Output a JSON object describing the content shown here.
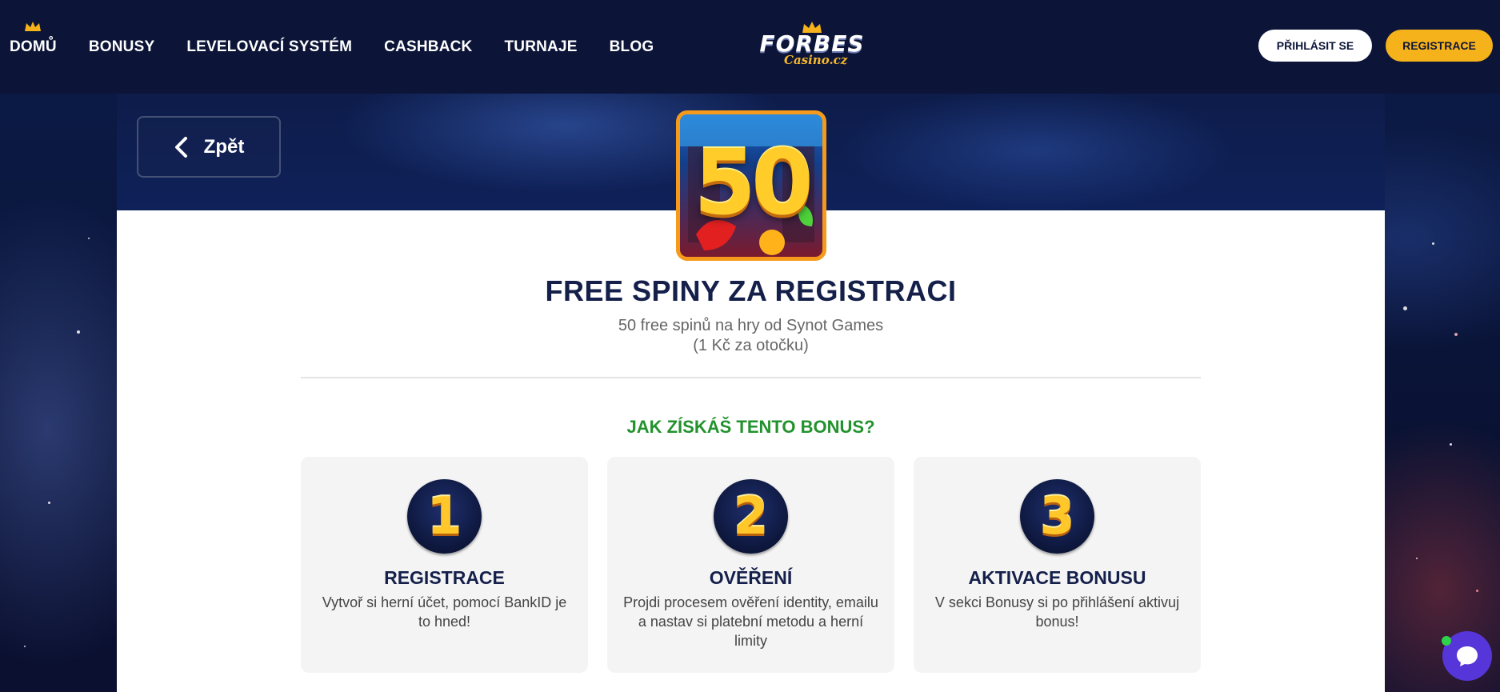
{
  "header": {
    "nav": [
      {
        "label": "DOMŮ"
      },
      {
        "label": "BONUSY"
      },
      {
        "label": "LEVELOVACÍ SYSTÉM"
      },
      {
        "label": "CASHBACK"
      },
      {
        "label": "TURNAJE"
      },
      {
        "label": "BLOG"
      }
    ],
    "logo_main": "FORBES",
    "logo_sub": "Casino.cz",
    "login_label": "PŘIHLÁSIT SE",
    "register_label": "REGISTRACE"
  },
  "back": {
    "label": "Zpět",
    "icon": "chevron-left-icon"
  },
  "bonus": {
    "image_number": "50",
    "title": "FREE SPINY ZA REGISTRACI",
    "subtitle_line1": "50 free spinů na hry od Synot Games",
    "subtitle_line2": "(1 Kč za otočku)"
  },
  "how": {
    "title": "JAK ZÍSKÁŠ TENTO BONUS?",
    "steps": [
      {
        "number": "1",
        "title": "REGISTRACE",
        "desc": "Vytvoř si herní účet, pomocí BankID je to hned!"
      },
      {
        "number": "2",
        "title": "OVĚŘENÍ",
        "desc": "Projdi procesem ověření identity, emailu a nastav si platební metodu a herní limity"
      },
      {
        "number": "3",
        "title": "AKTIVACE BONUSU",
        "desc": "V sekci Bonusy si po přihlášení aktivuj bonus!"
      }
    ]
  },
  "colors": {
    "header_bg": "#0c1538",
    "accent_yellow": "#f5b21b",
    "green_heading": "#22922d",
    "chat": "#5636d8"
  },
  "chat": {
    "icon": "chat-bubble-icon"
  }
}
